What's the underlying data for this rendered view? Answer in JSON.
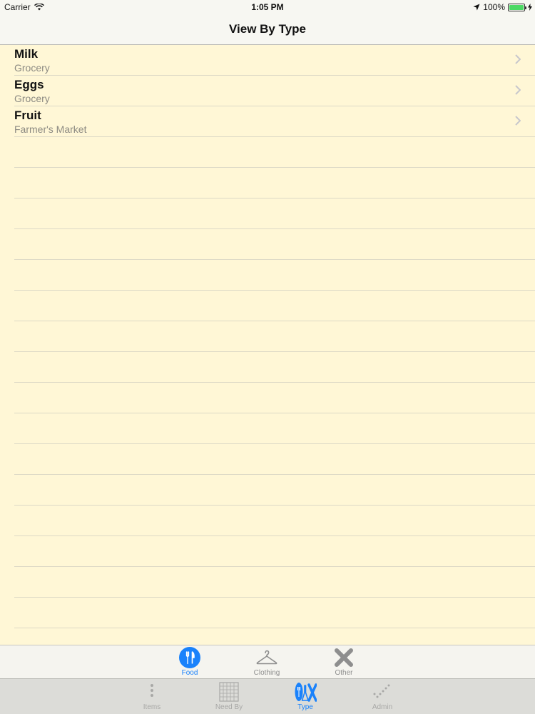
{
  "status_bar": {
    "carrier": "Carrier",
    "time": "1:05 PM",
    "battery": "100%"
  },
  "nav": {
    "title": "View By Type"
  },
  "list": {
    "items": [
      {
        "title": "Milk",
        "subtitle": "Grocery"
      },
      {
        "title": "Eggs",
        "subtitle": "Grocery"
      },
      {
        "title": "Fruit",
        "subtitle": "Farmer's Market"
      }
    ]
  },
  "type_tabs": [
    {
      "label": "Food",
      "icon": "fork-knife-icon",
      "active": true
    },
    {
      "label": "Clothing",
      "icon": "hanger-icon",
      "active": false
    },
    {
      "label": "Other",
      "icon": "x-icon",
      "active": false
    }
  ],
  "main_tabs": [
    {
      "label": "Items",
      "icon": "list-dots-icon",
      "active": false
    },
    {
      "label": "Need By",
      "icon": "calendar-icon",
      "active": false
    },
    {
      "label": "Type",
      "icon": "type-icon",
      "active": true
    },
    {
      "label": "Admin",
      "icon": "checkmark-icon",
      "active": false
    }
  ],
  "colors": {
    "background": "#fff7d6",
    "accent": "#1a82fb",
    "separator": "#ddd9c6"
  }
}
